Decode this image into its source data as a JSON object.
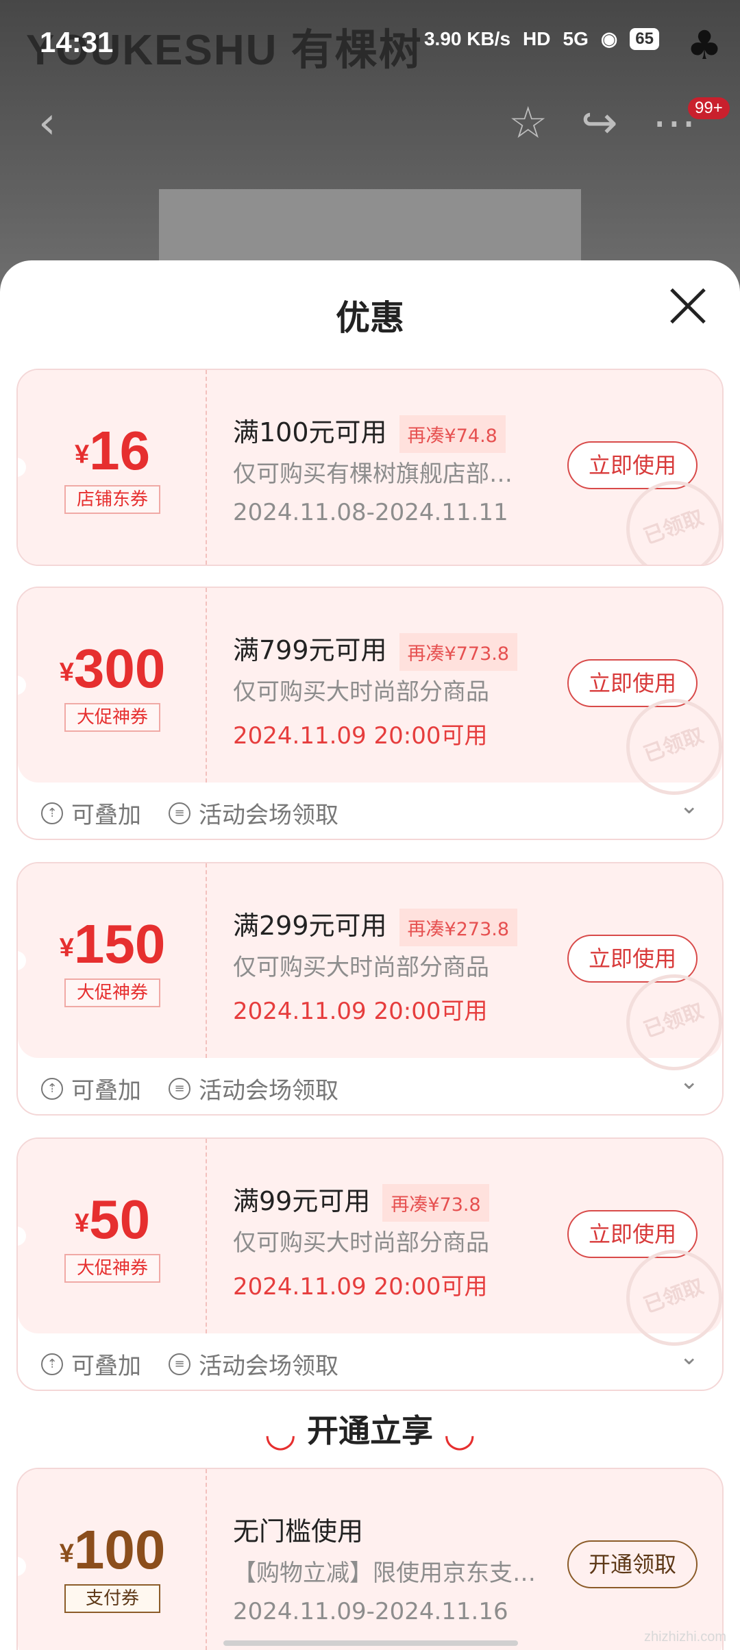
{
  "status": {
    "time": "14:31",
    "speed": "3.90 KB/s",
    "hd": "HD",
    "network": "5G",
    "battery": "65"
  },
  "background": {
    "brand": "YOUKESHU 有棵树",
    "badge": "99+"
  },
  "sheet": {
    "title": "优惠"
  },
  "coupons": [
    {
      "amount": "16",
      "symbol": "¥",
      "type": "店铺东券",
      "rule": "满100元可用",
      "extra": "再凑¥74.8",
      "desc": "仅可购买有棵树旗舰店部…",
      "date": "2024.11.08-2024.11.11",
      "action": "立即使用",
      "stamp": "已领取"
    },
    {
      "amount": "300",
      "symbol": "¥",
      "type": "大促神券",
      "rule": "满799元可用",
      "extra": "再凑¥773.8",
      "desc": "仅可购买大时尚部分商品",
      "date": "2024.11.09 20:00可用",
      "action": "立即使用",
      "stamp": "已领取",
      "foot1": "可叠加",
      "foot2": "活动会场领取"
    },
    {
      "amount": "150",
      "symbol": "¥",
      "type": "大促神券",
      "rule": "满299元可用",
      "extra": "再凑¥273.8",
      "desc": "仅可购买大时尚部分商品",
      "date": "2024.11.09 20:00可用",
      "action": "立即使用",
      "stamp": "已领取",
      "foot1": "可叠加",
      "foot2": "活动会场领取"
    },
    {
      "amount": "50",
      "symbol": "¥",
      "type": "大促神券",
      "rule": "满99元可用",
      "extra": "再凑¥73.8",
      "desc": "仅可购买大时尚部分商品",
      "date": "2024.11.09 20:00可用",
      "action": "立即使用",
      "stamp": "已领取",
      "foot1": "可叠加",
      "foot2": "活动会场领取"
    }
  ],
  "section": {
    "title": "开通立享"
  },
  "pay_coupon": {
    "amount": "100",
    "symbol": "¥",
    "type": "支付券",
    "rule": "无门槛使用",
    "desc": "【购物立减】限使用京东支…",
    "date": "2024.11.09-2024.11.16",
    "action": "开通领取"
  },
  "watermark": "zhizhizhi.com"
}
